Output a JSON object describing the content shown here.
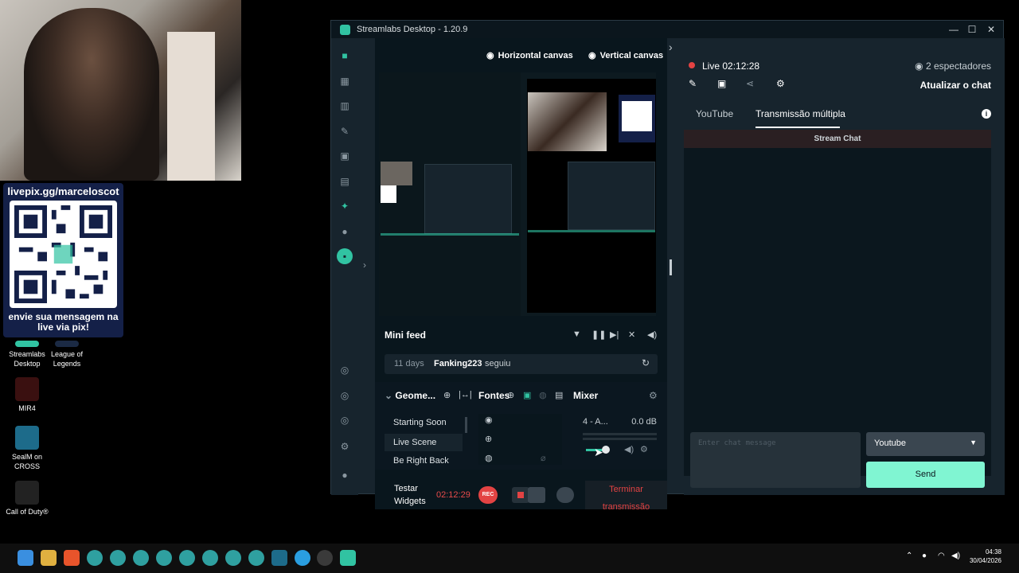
{
  "webcam": {},
  "qr_overlay": {
    "url": "livepix.gg/marceloscot",
    "message": "envie sua mensagem na live via pix!"
  },
  "desktop_icons": [
    {
      "label": "Streamlabs Desktop"
    },
    {
      "label": "League of Legends"
    },
    {
      "label": "MIR4"
    },
    {
      "label": "SealM on CROSS"
    },
    {
      "label": "Call of Duty®"
    }
  ],
  "window": {
    "title": "Streamlabs Desktop - 1.20.9",
    "minimize": "—",
    "maximize": "☐",
    "close": "✕"
  },
  "editor": {
    "horizontal_canvas": "Horizontal canvas",
    "vertical_canvas": "Vertical canvas",
    "mini_feed": {
      "title": "Mini feed",
      "events": [
        {
          "age": "11 days",
          "user": "Fanking223",
          "action": "seguiu"
        }
      ]
    },
    "scenes": {
      "title": "Geome...",
      "items": [
        "Starting Soon",
        "Live Scene",
        "Be Right Back"
      ]
    },
    "sources": {
      "title": "Fontes"
    },
    "mixer": {
      "title": "Mixer",
      "channel_name": "4 - A...",
      "level": "0.0 dB"
    },
    "bottom": {
      "test_widgets": "Testar Widgets",
      "timer": "02:12:29",
      "rec": "REC",
      "end_stream": "Terminar transmissão"
    }
  },
  "chat": {
    "live_label": "Live 02:12:28",
    "viewers": "2 espectadores",
    "refresh": "Atualizar o chat",
    "tabs": [
      "YouTube",
      "Transmissão múltipla"
    ],
    "header": "Stream Chat",
    "input_placeholder": "Enter chat message",
    "platform": "Youtube",
    "send": "Send"
  },
  "taskbar": {
    "time": "04:38",
    "date": "30/04/2026"
  },
  "colors": {
    "accent": "#31c3a2",
    "live_red": "#e34343",
    "send": "#80f5d2"
  }
}
